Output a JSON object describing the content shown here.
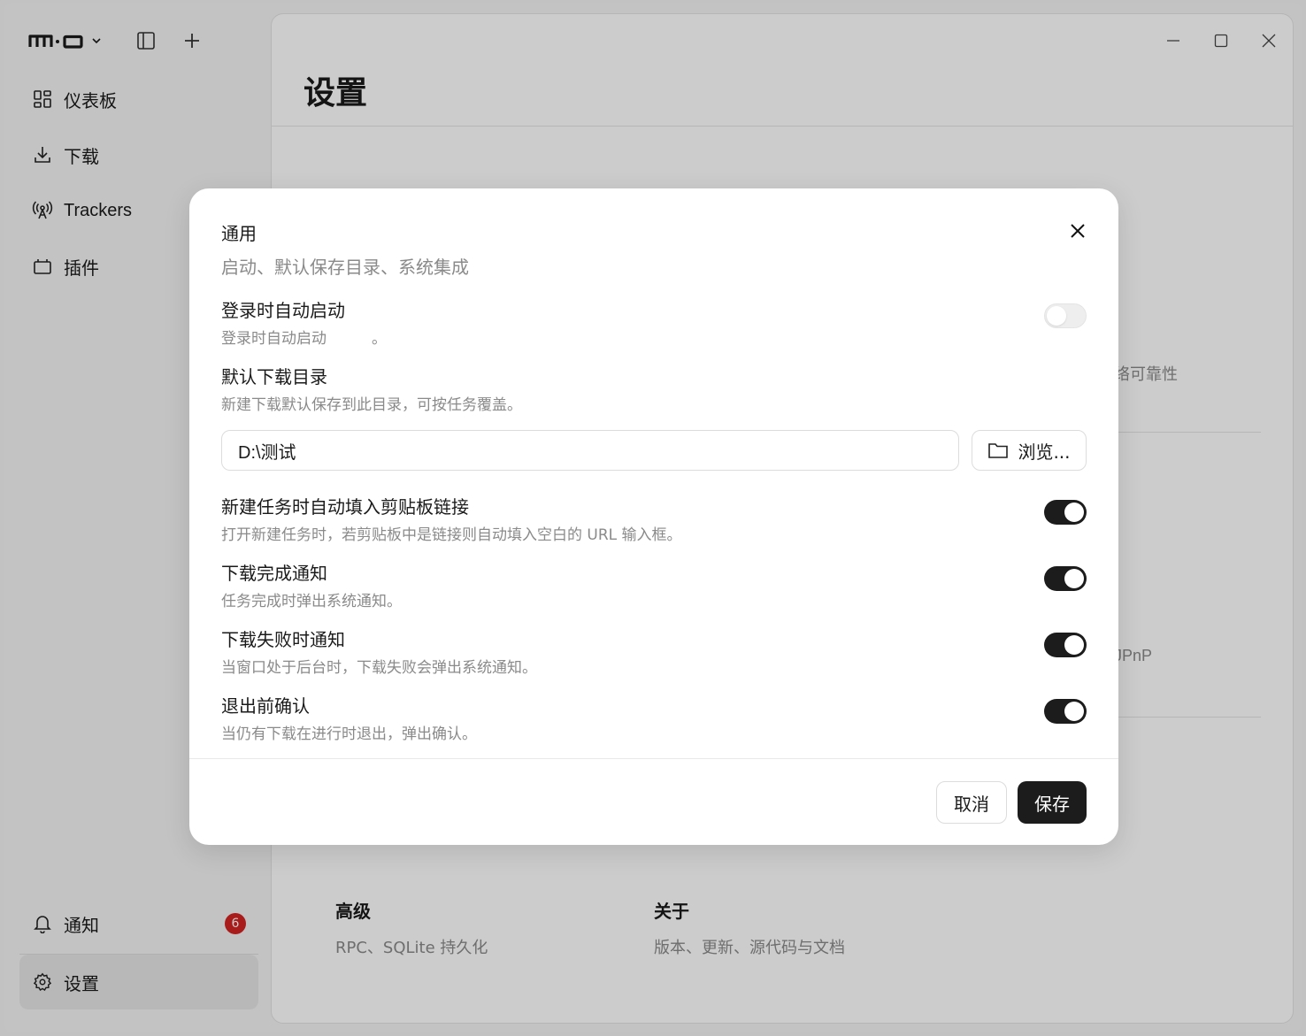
{
  "app": {
    "logo_text": "m·o",
    "sidebar": {
      "items": [
        {
          "label": "仪表板",
          "icon": "dashboard-icon"
        },
        {
          "label": "下载",
          "icon": "download-icon"
        },
        {
          "label": "Trackers",
          "icon": "antenna-icon"
        },
        {
          "label": "插件",
          "icon": "plugin-icon"
        }
      ],
      "notifications": {
        "label": "通知",
        "count": "6"
      },
      "settings": {
        "label": "设置"
      }
    }
  },
  "main": {
    "title": "设置",
    "peek_text_1": "络可靠性",
    "peek_text_2": "JPnP",
    "cards": [
      {
        "title": "高级",
        "desc": "RPC、SQLite 持久化"
      },
      {
        "title": "关于",
        "desc": "版本、更新、源代码与文档"
      }
    ]
  },
  "dialog": {
    "title": "通用",
    "subtitle": "启动、默认保存目录、系统集成",
    "rows": [
      {
        "title": "登录时自动启动",
        "desc": "登录时自动启动　　　。",
        "enabled": false
      },
      {
        "title": "默认下载目录",
        "desc": "新建下载默认保存到此目录，可按任务覆盖。"
      },
      {
        "title": "新建任务时自动填入剪贴板链接",
        "desc": "打开新建任务时，若剪贴板中是链接则自动填入空白的 URL 输入框。",
        "enabled": true
      },
      {
        "title": "下载完成通知",
        "desc": "任务完成时弹出系统通知。",
        "enabled": true
      },
      {
        "title": "下载失败时通知",
        "desc": "当窗口处于后台时，下载失败会弹出系统通知。",
        "enabled": true
      },
      {
        "title": "退出前确认",
        "desc": "当仍有下载在进行时退出，弹出确认。",
        "enabled": true
      }
    ],
    "download_dir": "D:\\测试",
    "browse_label": "浏览...",
    "cancel_label": "取消",
    "save_label": "保存"
  }
}
